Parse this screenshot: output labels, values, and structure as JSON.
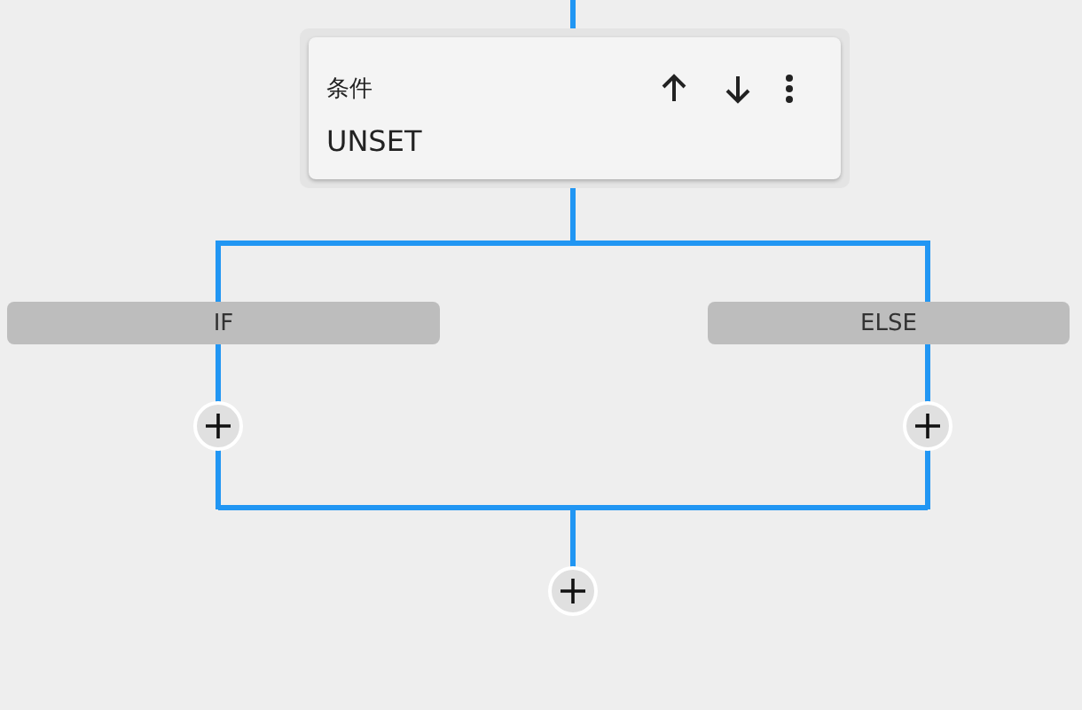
{
  "node": {
    "label": "条件",
    "value": "UNSET"
  },
  "branches": [
    {
      "label": "IF"
    },
    {
      "label": "ELSE"
    }
  ]
}
